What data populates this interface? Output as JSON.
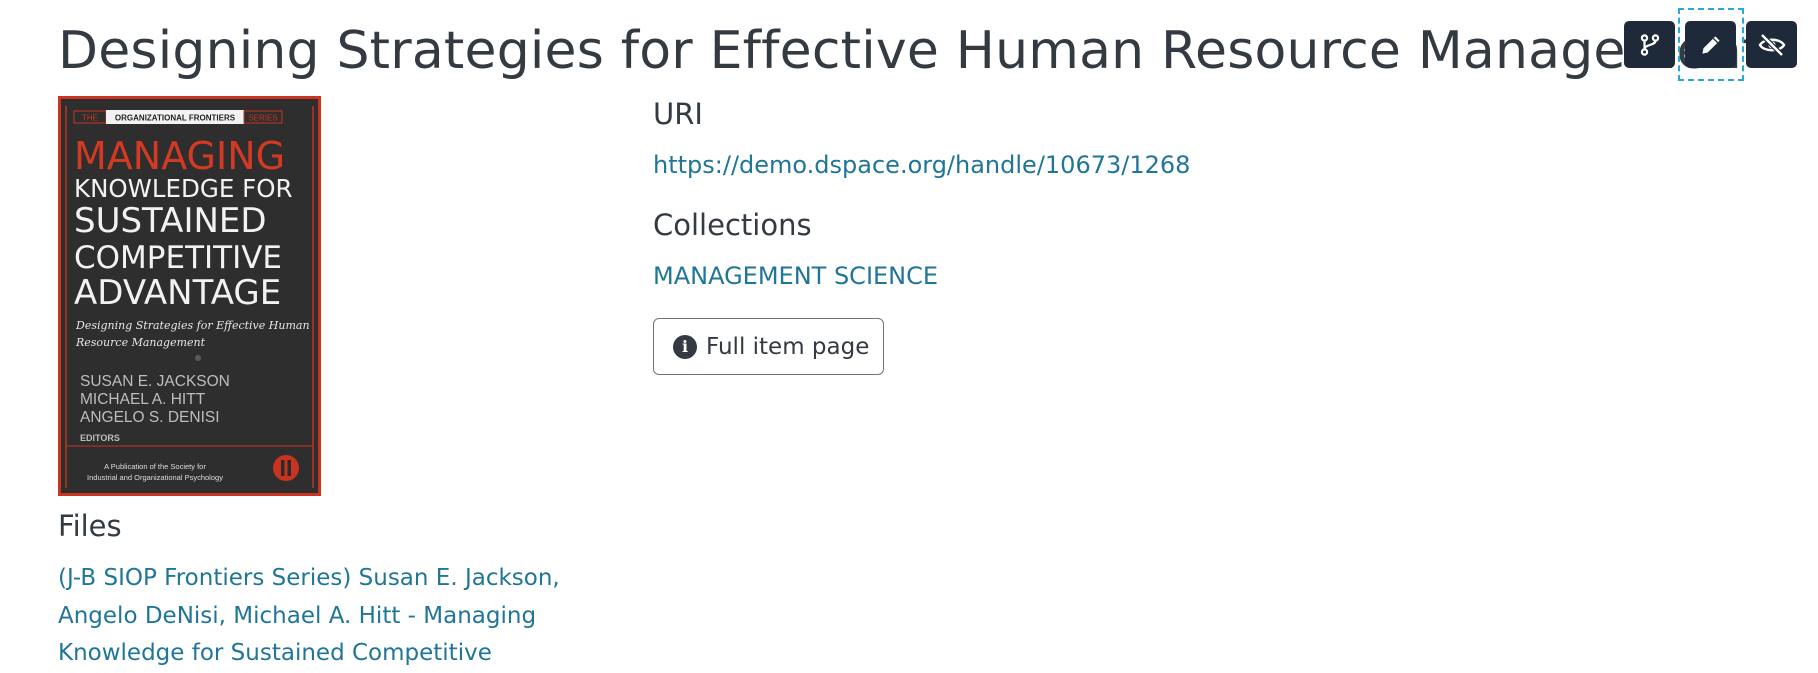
{
  "item": {
    "title": "Designing Strategies for Effective Human Resource Management"
  },
  "actions": {
    "icons": [
      "version-branch-icon",
      "pencil-edit-icon",
      "eye-slash-icon"
    ]
  },
  "cover": {
    "series_banner_left": "THE",
    "series_banner_name": "ORGANIZATIONAL FRONTIERS",
    "series_banner_right": "SERIES",
    "title_line_1": "MANAGING",
    "title_line_2": "KNOWLEDGE FOR",
    "title_line_3": "SUSTAINED",
    "title_line_4": "COMPETITIVE",
    "title_line_5": "ADVANTAGE",
    "subtitle_line_1": "Designing Strategies for Effective Human",
    "subtitle_line_2": "Resource Management",
    "editor_1": "SUSAN E. JACKSON",
    "editor_2": "MICHAEL A. HITT",
    "editor_3": "ANGELO S. DENISI",
    "editors_label": "EDITORS",
    "publication_line_1": "A Publication of the Society for",
    "publication_line_2": "Industrial and Organizational Psychology",
    "colors": {
      "background": "#2b2b2b",
      "frame": "#c8341f",
      "title_accent": "#d23a24"
    }
  },
  "files": {
    "heading": "Files",
    "link_text": "(J-B SIOP Frontiers Series) Susan E. Jackson, Angelo DeNisi, Michael A. Hitt - Managing Knowledge for Sustained Competitive"
  },
  "uri": {
    "heading": "URI",
    "link": "https://demo.dspace.org/handle/10673/1268"
  },
  "collections": {
    "heading": "Collections",
    "link": "MANAGEMENT SCIENCE"
  },
  "full_item": {
    "label": "Full item page",
    "icon": "info-circle-icon"
  },
  "colors": {
    "link": "#207698",
    "heading": "#333a41",
    "action_button_bg": "#1e2a3a",
    "focus_ring": "#2aa8d8"
  }
}
